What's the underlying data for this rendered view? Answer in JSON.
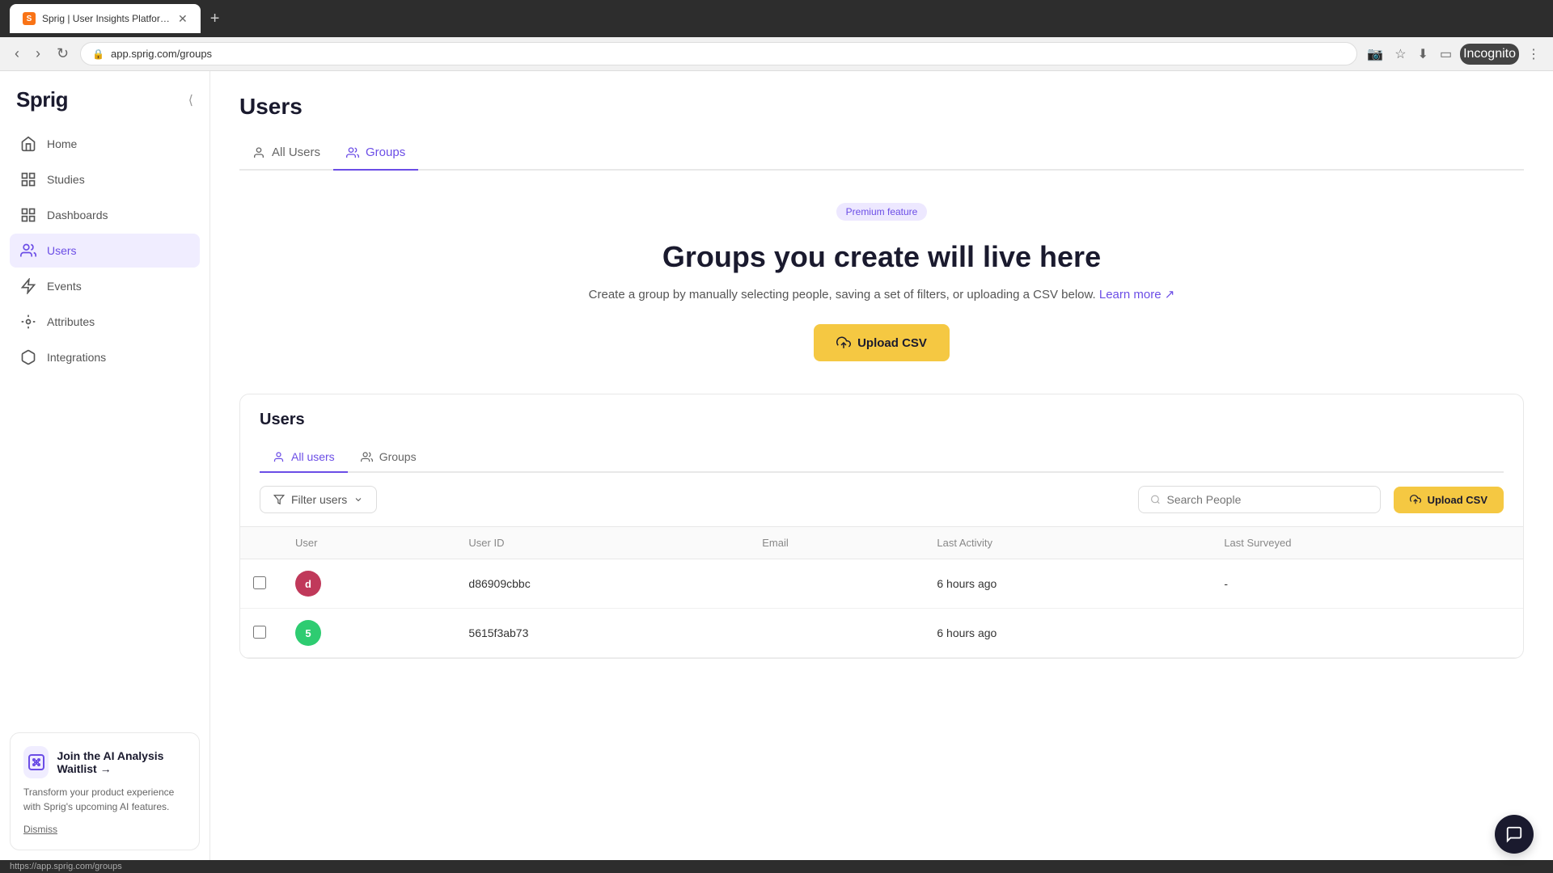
{
  "browser": {
    "tab_title": "Sprig | User Insights Platform for...",
    "tab_icon": "S",
    "url": "app.sprig.com/groups",
    "incognito_label": "Incognito"
  },
  "sidebar": {
    "logo": "Sprig",
    "nav_items": [
      {
        "id": "home",
        "label": "Home",
        "icon": "house"
      },
      {
        "id": "studies",
        "label": "Studies",
        "icon": "book"
      },
      {
        "id": "dashboards",
        "label": "Dashboards",
        "icon": "grid"
      },
      {
        "id": "users",
        "label": "Users",
        "icon": "person-group",
        "active": true
      },
      {
        "id": "events",
        "label": "Events",
        "icon": "lightning"
      },
      {
        "id": "attributes",
        "label": "Attributes",
        "icon": "tag"
      },
      {
        "id": "integrations",
        "label": "Integrations",
        "icon": "puzzle"
      }
    ],
    "ai_card": {
      "title": "Join the AI Analysis",
      "title_link": "Join the AI Analysis Waitlist →",
      "description": "Transform your product experience with Sprig's upcoming AI features.",
      "dismiss_label": "Dismiss"
    }
  },
  "page": {
    "title": "Users",
    "tabs": [
      {
        "id": "all-users",
        "label": "All Users",
        "active": false
      },
      {
        "id": "groups",
        "label": "Groups",
        "active": true
      }
    ]
  },
  "groups_section": {
    "premium_badge": "Premium feature",
    "heading": "Groups you create will live here",
    "description": "Create a group by manually selecting people, saving a set of filters, or uploading a CSV below.",
    "learn_more": "Learn more",
    "upload_csv_label": "Upload CSV"
  },
  "inner_panel": {
    "title": "Users",
    "tabs": [
      {
        "id": "all-users",
        "label": "All users",
        "active": true
      },
      {
        "id": "groups",
        "label": "Groups",
        "active": false
      }
    ],
    "filter_label": "Filter users",
    "search_placeholder": "Search People",
    "upload_csv_label": "Upload CSV",
    "table": {
      "columns": [
        "",
        "User",
        "User ID",
        "Email",
        "Last Activity",
        "Last Surveyed"
      ],
      "rows": [
        {
          "id": 1,
          "avatar_color": "#c0395a",
          "name": "",
          "user_id": "d86909cbbc",
          "email": "",
          "last_activity": "6 hours ago",
          "last_surveyed": "-"
        },
        {
          "id": 2,
          "avatar_color": "#2ecc71",
          "name": "",
          "user_id": "5615f3ab73",
          "email": "",
          "last_activity": "6 hours ago",
          "last_surveyed": ""
        }
      ]
    }
  },
  "status_bar": {
    "url": "https://app.sprig.com/groups"
  }
}
